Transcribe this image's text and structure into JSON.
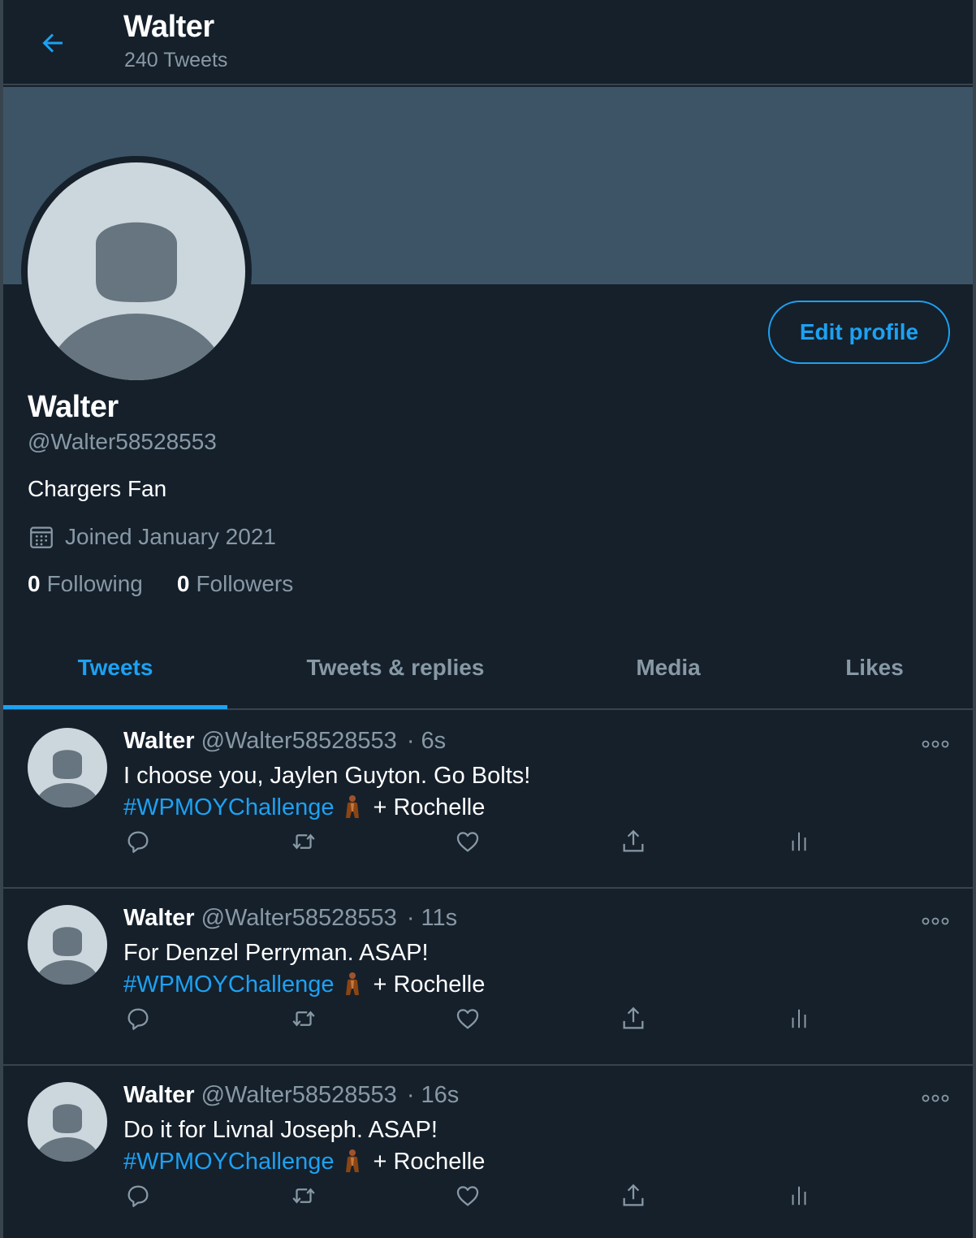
{
  "header": {
    "title": "Walter",
    "subtitle": "240 Tweets"
  },
  "profile": {
    "name": "Walter",
    "handle": "@Walter58528553",
    "bio": "Chargers Fan",
    "joined": "Joined January 2021",
    "following_count": "0",
    "following_label": "Following",
    "followers_count": "0",
    "followers_label": "Followers",
    "edit_label": "Edit profile"
  },
  "tabs": [
    {
      "label": "Tweets",
      "active": true
    },
    {
      "label": "Tweets & replies",
      "active": false
    },
    {
      "label": "Media",
      "active": false
    },
    {
      "label": "Likes",
      "active": false
    }
  ],
  "tweets": [
    {
      "name": "Walter",
      "handle": "@Walter58528553",
      "time": "· 6s",
      "text": "I choose you, Jaylen Guyton. Go Bolts!",
      "hashtag": "#WPMOYChallenge",
      "suffix": "+ Rochelle"
    },
    {
      "name": "Walter",
      "handle": "@Walter58528553",
      "time": "· 11s",
      "text": "For Denzel Perryman. ASAP!",
      "hashtag": "#WPMOYChallenge",
      "suffix": "+ Rochelle"
    },
    {
      "name": "Walter",
      "handle": "@Walter58528553",
      "time": "· 16s",
      "text": "Do it for Livnal Joseph. ASAP!",
      "hashtag": "#WPMOYChallenge",
      "suffix": "+ Rochelle"
    }
  ],
  "colors": {
    "background": "#15202b",
    "accent": "#1da1f2",
    "muted": "#8899a6",
    "banner": "#3d5466",
    "border": "#38444d"
  },
  "icons": [
    "back-arrow-icon",
    "calendar-icon",
    "reply-icon",
    "retweet-icon",
    "like-icon",
    "share-icon",
    "analytics-icon",
    "more-icon"
  ]
}
